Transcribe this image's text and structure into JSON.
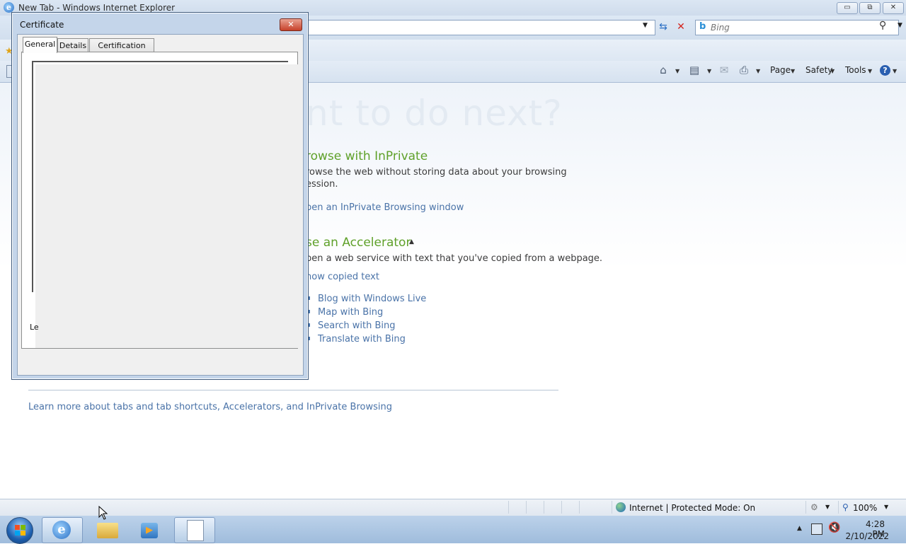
{
  "window": {
    "title": "New Tab - Windows Internet Explorer",
    "controls": {
      "minimize": "▭",
      "maximize": "⧉",
      "close": "✕"
    }
  },
  "navbar": {
    "search_placeholder": "Bing",
    "bing_glyph": "b"
  },
  "commandbar": {
    "items": [
      "Page",
      "Safety",
      "Tools"
    ]
  },
  "content": {
    "headline": "nt to do next?",
    "inprivate": {
      "title": "rowse with InPrivate",
      "text_line1": "rowse the web without storing data about your browsing",
      "text_line2": "ession.",
      "link": "pen an InPrivate Browsing window"
    },
    "accelerator": {
      "title": "se an Accelerator",
      "text": "pen a web service with text that you've copied from a webpage.",
      "show_link": "how copied text",
      "items": [
        "Blog with Windows Live",
        "Map with Bing",
        "Search with Bing",
        "Translate with Bing"
      ]
    },
    "learn_more": "Learn more about tabs and tab shortcuts, Accelerators, and InPrivate Browsing"
  },
  "statusbar": {
    "zone": "Internet | Protected Mode: On",
    "zoom": "100%"
  },
  "taskbar": {
    "time": "4:28 PM",
    "date": "2/10/2022"
  },
  "dialog": {
    "title": "Certificate",
    "close": "✕",
    "tabs": [
      "General",
      "Details",
      "Certification Path"
    ],
    "partial_label": "Le"
  },
  "colors": {
    "accent_green": "#5fa12a",
    "link_blue": "#4a73a8",
    "close_red": "#c7412a"
  }
}
